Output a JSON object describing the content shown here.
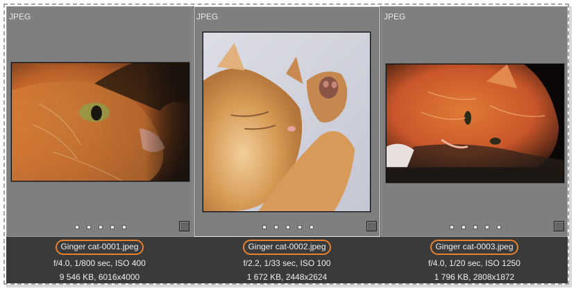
{
  "items": [
    {
      "format": "JPEG",
      "filename": "Ginger cat-0001.jpeg",
      "exposure": "f/4.0, 1/800 sec, ISO 400",
      "filesize": "9 546 KB, 6016x4000"
    },
    {
      "format": "JPEG",
      "filename": "Ginger cat-0002.jpeg",
      "exposure": "f/2.2, 1/33 sec, ISO 100",
      "filesize": "1 672 KB, 2448x2624"
    },
    {
      "format": "JPEG",
      "filename": "Ginger cat-0003.jpeg",
      "exposure": "f/4.0, 1/20 sec, ISO 1250",
      "filesize": "1 796 KB, 2808x1872"
    }
  ],
  "colors": {
    "thumb_bg": "#7f7f7f",
    "caption_bg": "#3a3a3a",
    "highlight": "#e8822e"
  }
}
